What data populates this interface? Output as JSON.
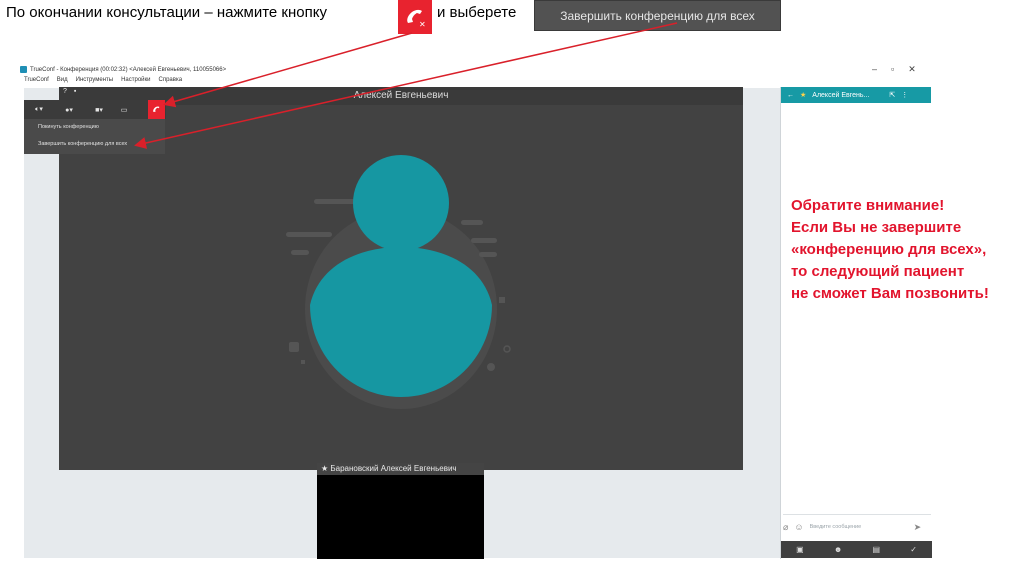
{
  "instruction": {
    "before_icon": "По окончании консультации – нажмите кнопку",
    "after_icon": "и выберете",
    "highlight_button_label": "Завершить конференцию для всех"
  },
  "window": {
    "title": "TrueConf - Конференция (00:02:32) <Алексей Евгеньевич, 110055066>",
    "controls": [
      "–",
      "▫",
      "✕"
    ]
  },
  "menu": [
    "TrueConf",
    "Вид",
    "Инструменты",
    "Настройки",
    "Справка"
  ],
  "video": {
    "participant_name": "Алексей Евгеньевич",
    "self_name": "Баранoвский Алексей Евгеньевич"
  },
  "toolbar": {
    "speaker_icon": "speaker-icon",
    "mic_icon": "mic-icon",
    "camera_icon": "camera-icon",
    "screen_icon": "screen-share-icon",
    "hangup_icon": "hangup-icon"
  },
  "dropdown": {
    "items": [
      "Покинуть конференцию",
      "Завершить конференцию для всех"
    ]
  },
  "side_panel": {
    "header_name": "Алексей Евгень...",
    "chat_placeholder": "Введите сообщение",
    "tabs": [
      "contacts-icon",
      "participants-icon",
      "chat-icon",
      "files-icon"
    ]
  },
  "notice": {
    "lines": [
      "Обратите внимание!",
      "Если Вы не завершите",
      "«конференцию для всех»,",
      "то следующий пациент",
      "не сможет Вам позвонить!"
    ]
  },
  "colors": {
    "accent": "#179aa5",
    "hangup_red": "#e8232f",
    "notice_red": "#e2142d",
    "arrow_red": "#d9202a",
    "avatar_teal": "#1697a2"
  }
}
